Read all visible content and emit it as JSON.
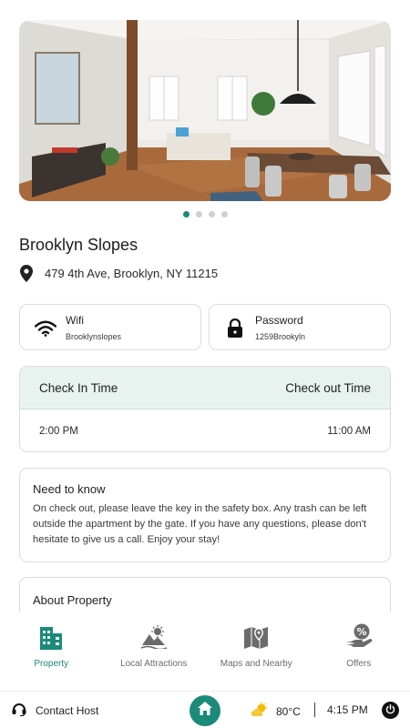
{
  "property": {
    "name": "Brooklyn Slopes",
    "address": "479 4th Ave, Brooklyn, NY 11215"
  },
  "carousel": {
    "count": 4,
    "active": 0
  },
  "wifi": {
    "label": "Wifi",
    "value": "Brooklynslopes"
  },
  "password": {
    "label": "Password",
    "value": "1259Brookyln"
  },
  "checkin": {
    "in_label": "Check In Time",
    "out_label": "Check out Time",
    "in_time": "2:00 PM",
    "out_time": "11:00 AM"
  },
  "need_to_know": {
    "title": "Need to know",
    "text": "On check out, please leave the key in the safety box. Any trash can be left outside the apartment by the gate. If you have any questions, please don't hesitate to give us a call. Enjoy your stay!"
  },
  "about": {
    "title": "About Property"
  },
  "tabs": [
    {
      "label": "Property",
      "icon": "building-icon",
      "active": true
    },
    {
      "label": "Local Attractions",
      "icon": "attractions-icon",
      "active": false
    },
    {
      "label": "Maps and Nearby",
      "icon": "map-icon",
      "active": false
    },
    {
      "label": "Offers",
      "icon": "offers-icon",
      "active": false
    }
  ],
  "bottom_bar": {
    "contact_label": "Contact Host",
    "temperature": "80°C",
    "time": "4:15 PM"
  },
  "colors": {
    "accent": "#1b8a7a",
    "checkin_header_bg": "#e8f3f0",
    "inactive_icon": "#6b6b6b"
  }
}
